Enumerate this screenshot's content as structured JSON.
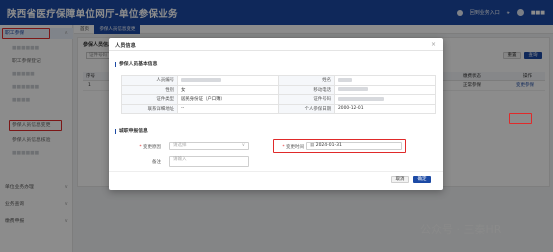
{
  "header": {
    "title": "陕西省医疗保障单位网厅-单位参保业务",
    "right_link": "回到业务入口",
    "username": "■■■"
  },
  "sidebar": {
    "items": [
      {
        "label": "职工参保",
        "active": true
      },
      {
        "label": "■■■■■■",
        "sub": true
      },
      {
        "label": "职工参保登记",
        "sub": true
      },
      {
        "label": "■■■■■",
        "sub": true
      },
      {
        "label": "■■■■■■",
        "sub": true
      },
      {
        "label": "■■■■",
        "sub": true
      },
      {
        "label": "参保人员信息变更",
        "sub": true,
        "highlight": true
      },
      {
        "label": "参保人员信息核验",
        "sub": true
      },
      {
        "label": "■■■■■■",
        "sub": true
      },
      {
        "label": "单位业务办理",
        "chev": "∨"
      },
      {
        "label": "业务查询",
        "chev": "∨"
      },
      {
        "label": "缴费申报",
        "chev": "∨"
      }
    ]
  },
  "breadcrumb": {
    "home": "首页",
    "tab": "参保人员信息变更"
  },
  "panel": {
    "title": "参保人员信息变更",
    "subtitle": "参保人员缴费信息",
    "search_placeholder": "证件号码",
    "reset_label": "重置",
    "query_label": "查询",
    "columns": [
      "序号",
      "姓名",
      "证件号码",
      "参保状态",
      "参保日期",
      "缴费状态",
      "操作"
    ],
    "row": {
      "index": "1",
      "status": "正常参保",
      "action": "变更参保"
    }
  },
  "modal": {
    "title": "人员信息",
    "section1": "参保人员基本信息",
    "fields": [
      {
        "label": "人员编号",
        "value": "",
        "label2": "姓名",
        "value2": ""
      },
      {
        "label": "性别",
        "value": "女",
        "label2": "移动电话",
        "value2": ""
      },
      {
        "label": "证件类型",
        "value": "居民身份证（户口簿）",
        "label2": "证件号码",
        "value2": ""
      },
      {
        "label": "联系详细地址",
        "value": "--",
        "label2": "个人参保日期",
        "value2": "2000-12-01"
      }
    ],
    "section2": "城职申报信息",
    "form": {
      "reason_label": "变更原因",
      "reason_placeholder": "请选择",
      "time_label": "变更时间",
      "time_value": "2024-01-31",
      "remark_label": "备注",
      "remark_placeholder": "请输入"
    },
    "cancel_label": "取消",
    "confirm_label": "确定"
  },
  "watermark": "公众号 · 三秦HR",
  "colors": {
    "brand": "#1c4aa5",
    "highlight": "#e02a2a"
  }
}
